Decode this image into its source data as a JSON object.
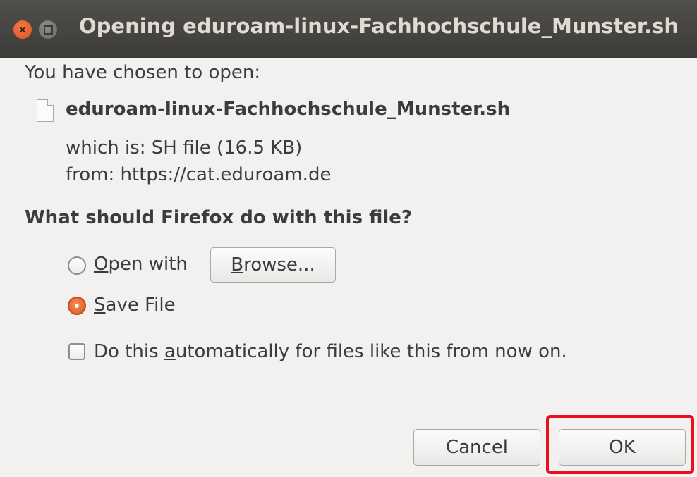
{
  "window": {
    "title": "Opening eduroam-linux-Fachhochschule_Munster.sh"
  },
  "dialog": {
    "intro": "You have chosen to open:",
    "file_name": "eduroam-linux-Fachhochschule_Munster.sh",
    "file_type_line": "which is: SH file (16.5 KB)",
    "source_line": "from: https://cat.eduroam.de",
    "question": "What should Firefox do with this file?",
    "options": {
      "open_with": {
        "pre": "",
        "mnemonic": "O",
        "post": "pen with",
        "selected": false
      },
      "browse_button": {
        "pre": "",
        "mnemonic": "B",
        "post": "rowse..."
      },
      "save_file": {
        "pre": "",
        "mnemonic": "S",
        "post": "ave File",
        "selected": true
      },
      "auto": {
        "pre": "Do this ",
        "mnemonic": "a",
        "post": "utomatically for files like this from now on.",
        "checked": false
      }
    },
    "buttons": {
      "cancel": "Cancel",
      "ok": "OK"
    }
  }
}
